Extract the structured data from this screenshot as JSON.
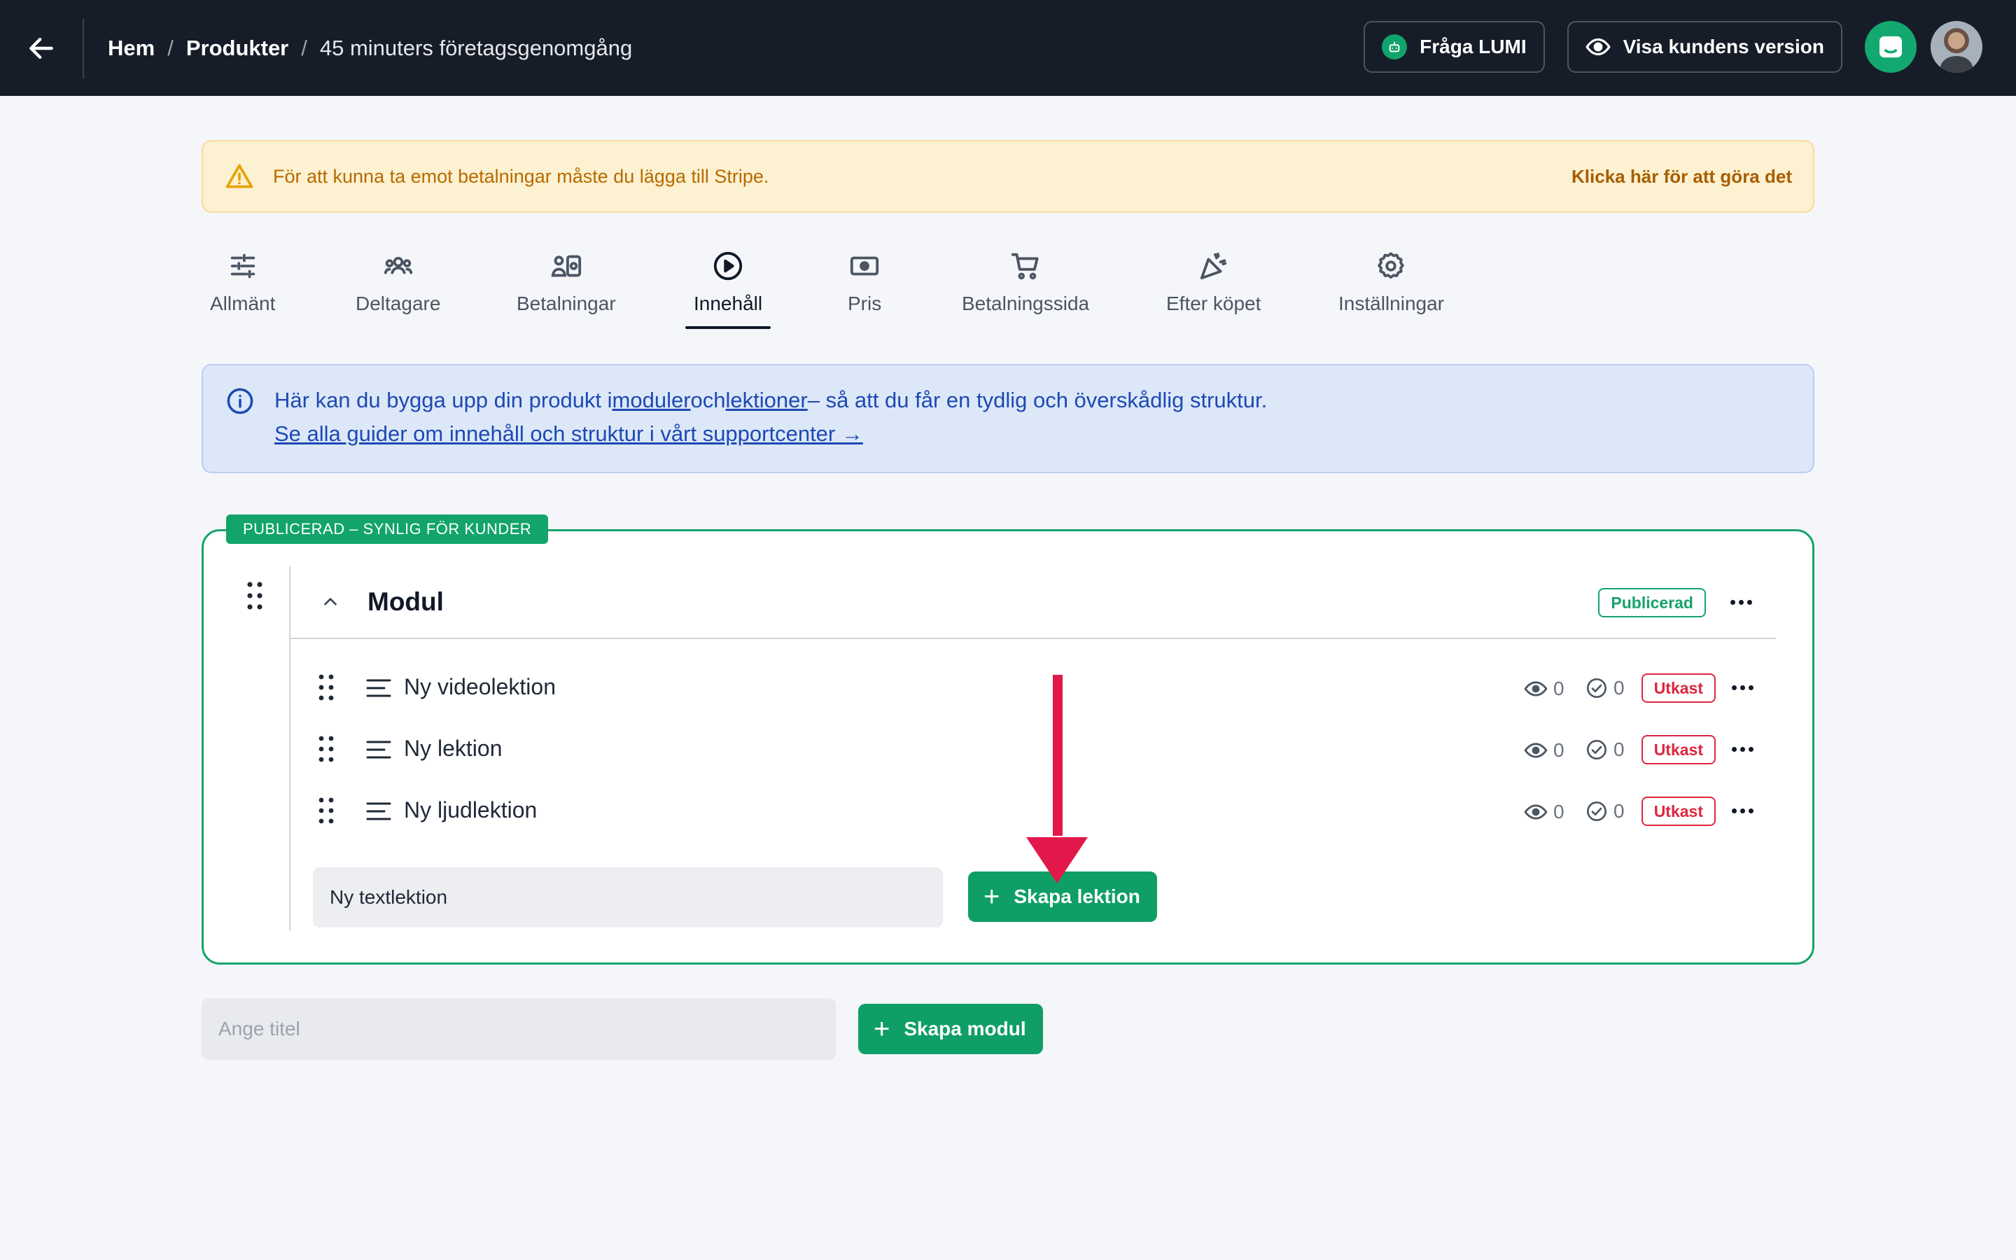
{
  "breadcrumb": {
    "home": "Hem",
    "separator": "/",
    "products": "Produkter",
    "current": "45 minuters företagsgenomgång"
  },
  "header": {
    "ask_lumi": "Fråga LUMI",
    "customer_view": "Visa kundens version"
  },
  "warning": {
    "message": "För att kunna ta emot betalningar måste du lägga till Stripe.",
    "action": "Klicka här för att göra det"
  },
  "tabs": [
    {
      "label": "Allmänt",
      "icon": "sliders-icon"
    },
    {
      "label": "Deltagare",
      "icon": "users-icon"
    },
    {
      "label": "Betalningar",
      "icon": "payments-icon"
    },
    {
      "label": "Innehåll",
      "icon": "play-circle-icon",
      "active": true
    },
    {
      "label": "Pris",
      "icon": "banknote-icon"
    },
    {
      "label": "Betalningssida",
      "icon": "cart-icon"
    },
    {
      "label": "Efter köpet",
      "icon": "party-popper-icon"
    },
    {
      "label": "Inställningar",
      "icon": "gear-icon"
    }
  ],
  "info": {
    "text_before": "Här kan du bygga upp din produkt i",
    "link_modules": "moduler",
    "text_and": "och",
    "link_lessons": "lektioner",
    "text_after": "– så att du får en tydlig och överskådlig struktur.",
    "guide_link": "Se alla guider om innehåll och struktur i vårt supportcenter →"
  },
  "module": {
    "tag": "PUBLICERAD – SYNLIG FÖR KUNDER",
    "title": "Modul",
    "status": "Publicerad",
    "lessons": [
      {
        "title": "Ny videolektion",
        "views": "0",
        "completed": "0",
        "status": "Utkast"
      },
      {
        "title": "Ny lektion",
        "views": "0",
        "completed": "0",
        "status": "Utkast"
      },
      {
        "title": "Ny ljudlektion",
        "views": "0",
        "completed": "0",
        "status": "Utkast"
      }
    ],
    "new_lesson_value": "Ny textlektion",
    "create_lesson": "Skapa lektion"
  },
  "new_module": {
    "placeholder": "Ange titel",
    "create_module": "Skapa modul"
  },
  "colors": {
    "topbar": "#161d29",
    "accent_green": "#0f9f66",
    "draft_red": "#dc2640",
    "arrow_red": "#e3184a"
  }
}
